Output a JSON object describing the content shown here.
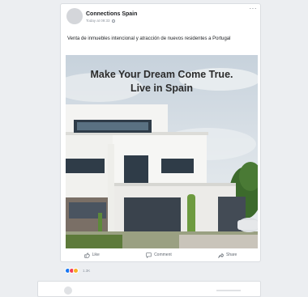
{
  "post": {
    "page_name": "Connections Spain",
    "timestamp": "Today at 09:33",
    "more_icon": "ellipsis-icon",
    "caption": "Venta de inmuebles intencional y atracción de nuevos residentes a Portugal",
    "image": {
      "headline_line1": "Make Your Dream Come True.",
      "headline_line2": "Live in Spain",
      "description": "modern white house with driveway"
    },
    "actions": {
      "like_label": "Like",
      "comment_label": "Comment",
      "share_label": "Share"
    },
    "reactions": {
      "count": "1.3K",
      "icons": [
        "like-reaction-icon",
        "love-reaction-icon",
        "haha-reaction-icon"
      ]
    }
  },
  "colors": {
    "background": "#eceef1",
    "card": "#ffffff",
    "like_blue": "#1877f2",
    "love_red": "#f33e58",
    "haha_yellow": "#f7b125"
  }
}
